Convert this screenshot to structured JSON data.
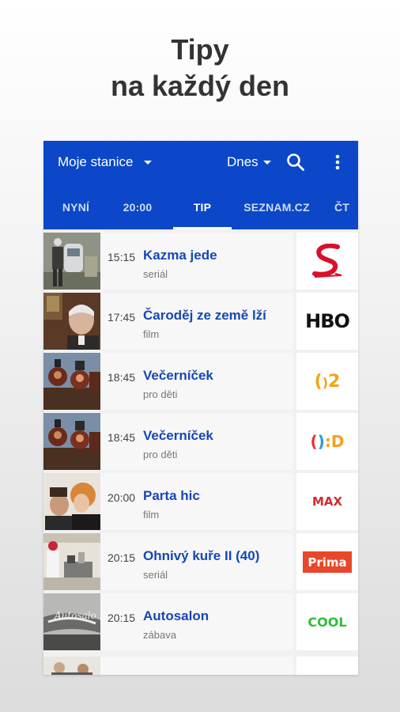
{
  "headline": {
    "line1": "Tipy",
    "line2": "na každý den"
  },
  "appbar": {
    "station_label": "Moje stanice",
    "day_label": "Dnes",
    "color": "#0b47c8"
  },
  "tabs": [
    {
      "label": "NYNÍ",
      "active": false
    },
    {
      "label": "20:00",
      "active": false
    },
    {
      "label": "TIP",
      "active": true
    },
    {
      "label": "SEZNAM.CZ",
      "active": false
    },
    {
      "label": "ČT",
      "active": false
    }
  ],
  "programs": [
    {
      "time": "15:15",
      "title": "Kazma jede",
      "genre": "seriál",
      "channel_logo": "S"
    },
    {
      "time": "17:45",
      "title": "Čaroděj ze země lží",
      "genre": "film",
      "channel_logo": "HBO"
    },
    {
      "time": "18:45",
      "title": "Večerníček",
      "genre": "pro děti",
      "channel_logo": "2"
    },
    {
      "time": "18:45",
      "title": "Večerníček",
      "genre": "pro děti",
      "channel_logo": ":D"
    },
    {
      "time": "20:00",
      "title": "Parta hic",
      "genre": "film",
      "channel_logo": "MAX"
    },
    {
      "time": "20:15",
      "title": "Ohnivý kuře II (40)",
      "genre": "seriál",
      "channel_logo": "Prima"
    },
    {
      "time": "20:15",
      "title": "Autosalon",
      "genre": "zábava",
      "channel_logo": "COOL"
    }
  ]
}
